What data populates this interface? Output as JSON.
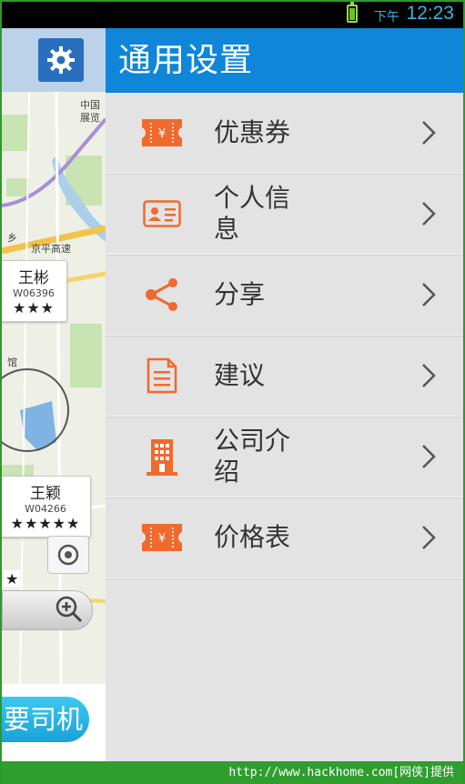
{
  "status_bar": {
    "ampm": "下午",
    "time": "12:23",
    "icons": [
      "battery-icon"
    ]
  },
  "map": {
    "place_labels": [
      "中国",
      "展览",
      "乡",
      "京平高速",
      "馆"
    ],
    "drivers": [
      {
        "name": "王彬",
        "id": "W06396",
        "stars": "★★★"
      },
      {
        "name": "王颖",
        "id": "W04266",
        "stars": "★★★★★"
      }
    ],
    "extra_star": "★",
    "call_button": "要司机"
  },
  "drawer": {
    "title": "通用设置",
    "items": [
      {
        "label": "优惠券",
        "icon": "coupon-icon"
      },
      {
        "label": "个人信息",
        "icon": "id-card-icon"
      },
      {
        "label": "分享",
        "icon": "share-icon"
      },
      {
        "label": "建议",
        "icon": "document-icon"
      },
      {
        "label": "公司介绍",
        "icon": "building-icon"
      },
      {
        "label": "价格表",
        "icon": "price-ticket-icon"
      }
    ]
  },
  "colors": {
    "accent_blue": "#0f86d7",
    "icon_orange": "#f06a2e",
    "drawer_bg": "#e3e3e3"
  },
  "footer": {
    "text": "http://www.hackhome.com[网侠]提供"
  }
}
